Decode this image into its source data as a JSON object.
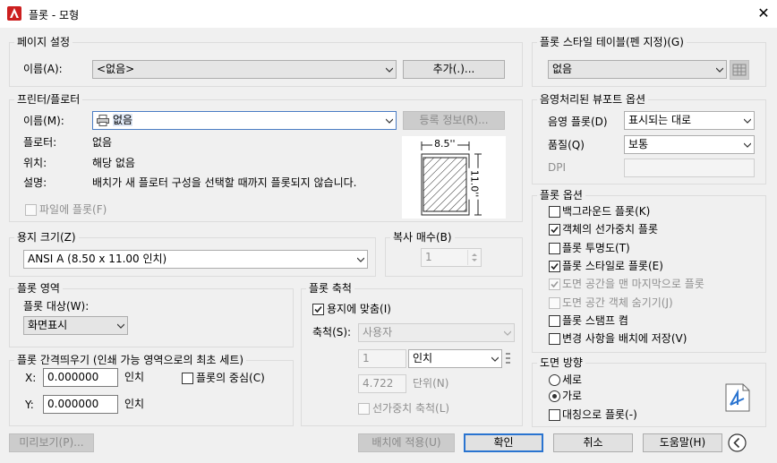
{
  "window": {
    "title": "플롯 - 모형",
    "close": "✕"
  },
  "page_setup": {
    "group": "페이지 설정",
    "name_label": "이름(A):",
    "name_value": "<없음>",
    "add_button": "추가(.)..."
  },
  "printer": {
    "group": "프린터/플로터",
    "name_label": "이름(M):",
    "name_value": "없음",
    "properties_button": "등록 정보(R)...",
    "plotter_label": "플로터:",
    "plotter_value": "없음",
    "location_label": "위치:",
    "location_value": "해당 없음",
    "description_label": "설명:",
    "description_value": "배치가 새 플로터 구성을 선택할 때까지 플롯되지 않습니다.",
    "plot_to_file": "파일에 플롯(F)",
    "preview_width": "8.5''",
    "preview_height": "11.0''"
  },
  "paper_size": {
    "group": "용지 크기(Z)",
    "value": "ANSI A (8.50 x 11.00 인치)"
  },
  "copies": {
    "group": "복사 매수(B)",
    "value": "1"
  },
  "plot_area": {
    "group": "플롯 영역",
    "what_label": "플롯 대상(W):",
    "what_value": "화면표시"
  },
  "plot_offset": {
    "group": "플롯 간격띄우기 (인쇄 가능 영역으로의 최초 세트)",
    "x_label": "X:",
    "x_value": "0.000000",
    "x_unit": "인치",
    "y_label": "Y:",
    "y_value": "0.000000",
    "y_unit": "인치",
    "center": "플롯의 중심(C)"
  },
  "plot_scale": {
    "group": "플롯 축척",
    "fit": "용지에 맞춤(I)",
    "scale_label": "축척(S):",
    "scale_value": "사용자",
    "value1": "1",
    "unit1": "인치",
    "value2": "4.722",
    "unit2": "단위(N)",
    "lineweights": "선가중치 축척(L)"
  },
  "style_table": {
    "group": "플롯 스타일 테이블(펜 지정)(G)",
    "value": "없음"
  },
  "shaded_viewport": {
    "group": "음영처리된 뷰포트 옵션",
    "shade_label": "음영 플롯(D)",
    "shade_value": "표시되는 대로",
    "quality_label": "품질(Q)",
    "quality_value": "보통",
    "dpi_label": "DPI"
  },
  "plot_options": {
    "group": "플롯 옵션",
    "items": [
      {
        "label": "백그라운드 플롯(K)",
        "checked": false,
        "disabled": false
      },
      {
        "label": "객체의 선가중치 플롯",
        "checked": true,
        "disabled": false
      },
      {
        "label": "플롯 투명도(T)",
        "checked": false,
        "disabled": false
      },
      {
        "label": "플롯 스타일로 플롯(E)",
        "checked": true,
        "disabled": false
      },
      {
        "label": "도면 공간을 맨 마지막으로 플롯",
        "checked": true,
        "disabled": true
      },
      {
        "label": "도면 공간 객체 숨기기(J)",
        "checked": false,
        "disabled": true
      },
      {
        "label": "플롯 스탬프 켬",
        "checked": false,
        "disabled": false
      },
      {
        "label": "변경 사항을 배치에 저장(V)",
        "checked": false,
        "disabled": false
      }
    ]
  },
  "orientation": {
    "group": "도면 방향",
    "portrait": "세로",
    "landscape": "가로",
    "upside_down": "대칭으로 플롯(-)"
  },
  "footer": {
    "preview": "미리보기(P)...",
    "apply": "배치에 적용(U)",
    "ok": "확인",
    "cancel": "취소",
    "help": "도움말(H)"
  },
  "colors": {
    "accent": "#2a74d0",
    "logo": "#cc1f1f"
  }
}
